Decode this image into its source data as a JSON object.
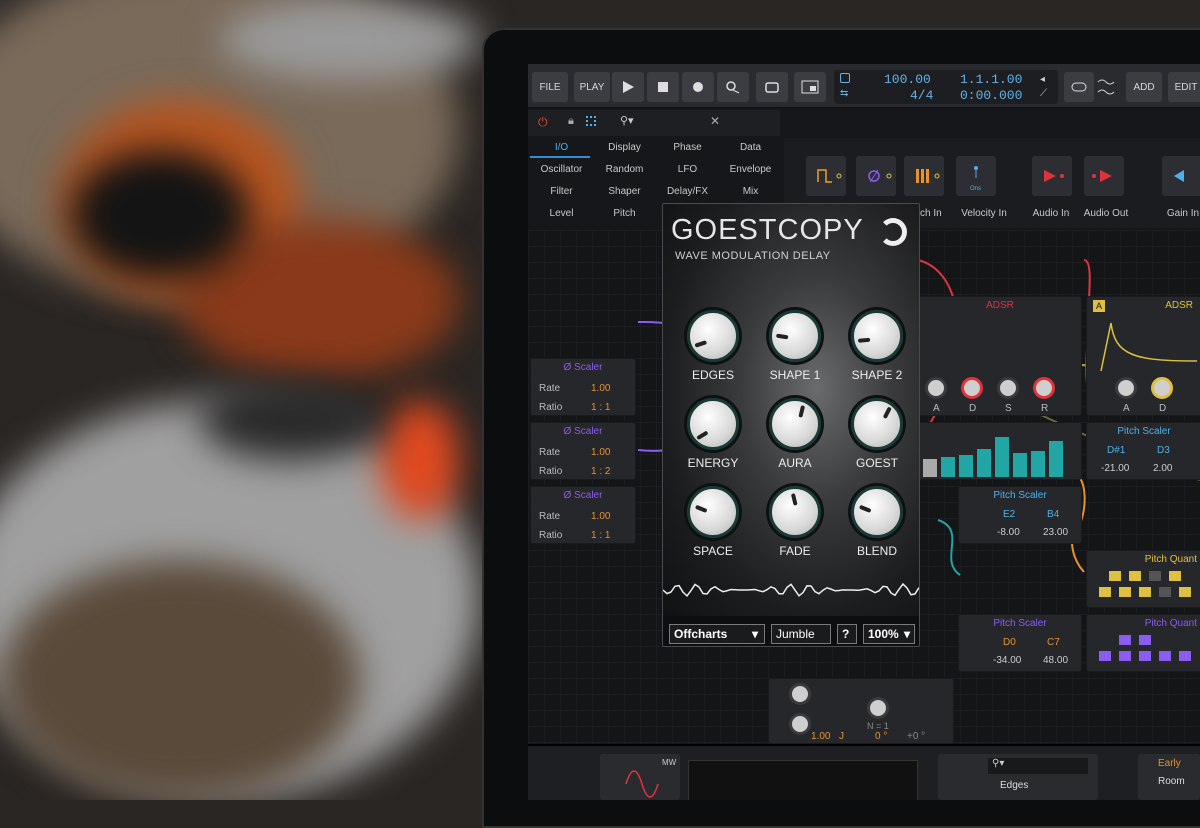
{
  "toolbar": {
    "file_label": "FILE",
    "play_label": "PLAY",
    "add_label": "ADD",
    "edit_label": "EDIT",
    "tempo": "100.00",
    "time_signature": "4/4",
    "position_bars": "1.1.1.00",
    "position_time": "0:00.000"
  },
  "device_categories": [
    "I/O",
    "Display",
    "Phase",
    "Data",
    "Oscillator",
    "Random",
    "LFO",
    "Envelope",
    "Filter",
    "Shaper",
    "Delay/FX",
    "Mix",
    "Level",
    "Pitch"
  ],
  "active_category": "I/O",
  "modules_header": [
    "Pitch In",
    "Velocity In",
    "Audio In",
    "Audio Out",
    "Gain In"
  ],
  "velocity_tile_text": "Ons",
  "scalers": [
    {
      "title": "Ø Scaler",
      "rate": "1.00",
      "ratio": "1 : 1",
      "rate_label": "Rate",
      "ratio_label": "Ratio"
    },
    {
      "title": "Ø Scaler",
      "rate": "1.00",
      "ratio": "1 : 2",
      "rate_label": "Rate",
      "ratio_label": "Ratio"
    },
    {
      "title": "Ø Scaler",
      "rate": "1.00",
      "ratio": "1 : 1",
      "rate_label": "Rate",
      "ratio_label": "Ratio"
    }
  ],
  "adsr": {
    "title": "ADSR",
    "knobs": [
      "A",
      "D",
      "S",
      "R"
    ]
  },
  "adsr_right": {
    "title": "ADSR",
    "badge": "A",
    "knobs": [
      "A",
      "D"
    ]
  },
  "pitch_scalers": [
    {
      "title": "Pitch Scaler",
      "note1": "D#1",
      "note2": "D3",
      "val1": "-21.00",
      "val2": "2.00"
    },
    {
      "title": "Pitch Scaler",
      "note1": "E2",
      "note2": "B4",
      "val1": "-8.00",
      "val2": "23.00"
    },
    {
      "title": "Pitch Scaler",
      "note1": "D0",
      "note2": "C7",
      "val1": "-34.00",
      "val2": "48.00"
    }
  ],
  "pitch_quantize_label": "Pitch Quant",
  "osc_module": {
    "value": "1.00",
    "unit": "J",
    "zero": "0",
    "degree": "0 °",
    "degree2": "+0 °",
    "nequals": "N = 1"
  },
  "plugin": {
    "title": "GOESTCOPY",
    "subtitle": "WAVE MODULATION DELAY",
    "knobs": [
      {
        "label": "EDGES",
        "value": 0.1
      },
      {
        "label": "SHAPE 1",
        "value": 0.2
      },
      {
        "label": "SHAPE 2",
        "value": 0.15
      },
      {
        "label": "ENERGY",
        "value": 0.05
      },
      {
        "label": "AURA",
        "value": 0.55
      },
      {
        "label": "GOEST",
        "value": 0.6
      },
      {
        "label": "SPACE",
        "value": 0.25
      },
      {
        "label": "FADE",
        "value": 0.45
      },
      {
        "label": "BLEND",
        "value": 0.25
      }
    ],
    "preset": "Offcharts",
    "jumble": "Jumble",
    "help": "?",
    "zoom": "100%"
  },
  "bottom": {
    "osc_label": "MW",
    "search_value": "Edges",
    "device_right": "Early",
    "device_right2": "Room"
  },
  "colors": {
    "accent_blue": "#4fb0ea",
    "orange": "#e8922b",
    "purple": "#8a5cf0",
    "yellow": "#e0c040",
    "teal": "#22a5a5",
    "red": "#e0343c"
  }
}
